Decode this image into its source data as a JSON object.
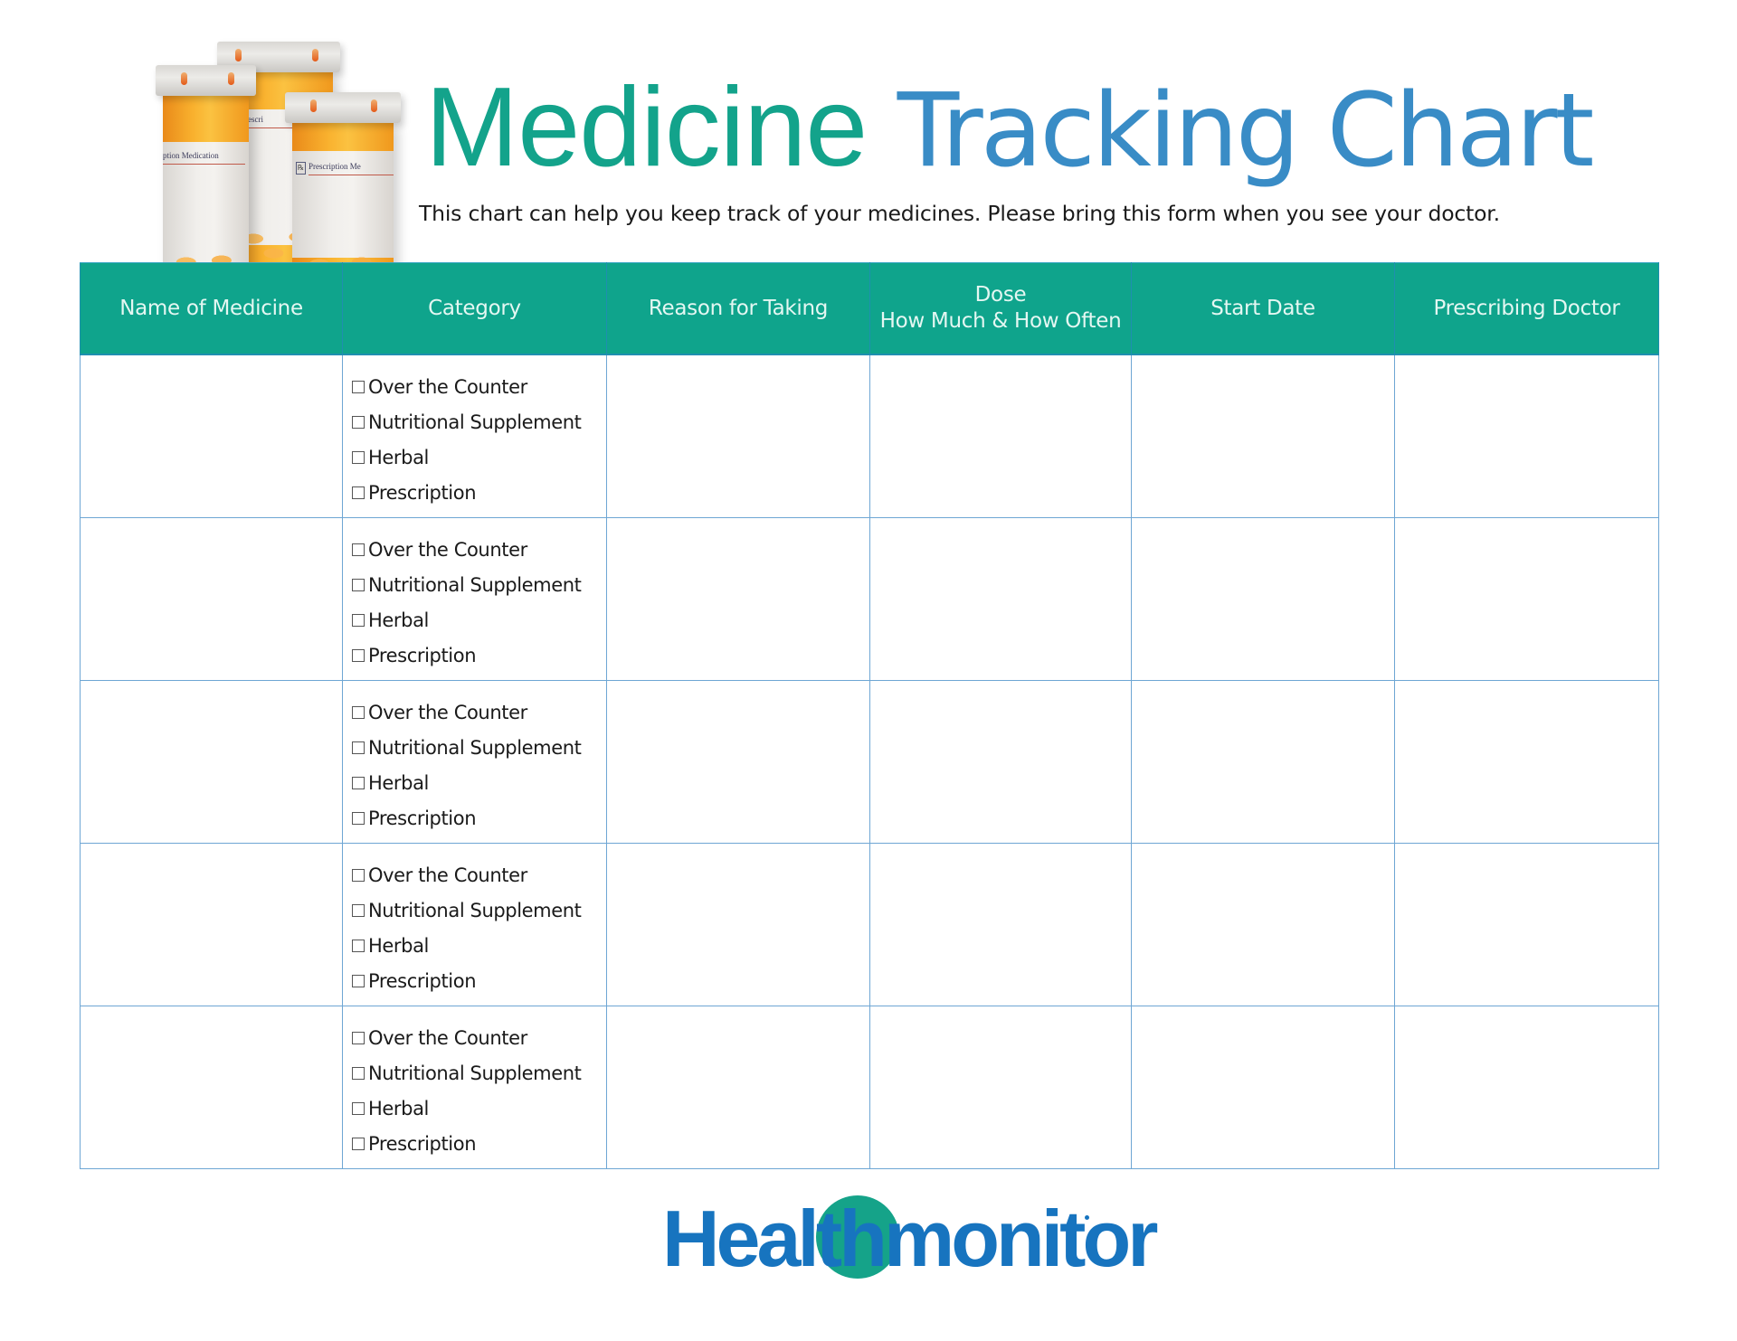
{
  "header": {
    "title_part1": "Medicine",
    "title_part2": "Tracking Chart",
    "subtitle": "This chart can help you keep track of your medicines. Please bring this form when you see your doctor."
  },
  "illustration": {
    "icon": "prescription-bottles-icon",
    "bottle_labels": [
      "ption Medication",
      "Prescri",
      "Prescription Me"
    ],
    "rx_symbol": "℞"
  },
  "table": {
    "columns": [
      {
        "label": "Name of Medicine"
      },
      {
        "label": "Category"
      },
      {
        "label": "Reason for Taking"
      },
      {
        "label_line1": "Dose",
        "label_line2": "How Much & How Often"
      },
      {
        "label": "Start Date"
      },
      {
        "label": "Prescribing Doctor"
      }
    ],
    "category_options": [
      "Over the Counter",
      "Nutritional Supplement",
      "Herbal",
      "Prescription"
    ],
    "rows": [
      {
        "name": "",
        "reason": "",
        "dose": "",
        "start_date": "",
        "doctor": "",
        "checked": [
          false,
          false,
          false,
          false
        ]
      },
      {
        "name": "",
        "reason": "",
        "dose": "",
        "start_date": "",
        "doctor": "",
        "checked": [
          false,
          false,
          false,
          false
        ]
      },
      {
        "name": "",
        "reason": "",
        "dose": "",
        "start_date": "",
        "doctor": "",
        "checked": [
          false,
          false,
          false,
          false
        ]
      },
      {
        "name": "",
        "reason": "",
        "dose": "",
        "start_date": "",
        "doctor": "",
        "checked": [
          false,
          false,
          false,
          false
        ]
      },
      {
        "name": "",
        "reason": "",
        "dose": "",
        "start_date": "",
        "doctor": "",
        "checked": [
          false,
          false,
          false,
          false
        ]
      }
    ]
  },
  "footer": {
    "logo_text_part1": "Healt",
    "logo_text_part2": "h",
    "logo_text_part3": "monitor"
  },
  "colors": {
    "teal": "#0fa48c",
    "blue": "#2f86c4",
    "grid": "#6ea6d4",
    "logo_blue": "#1774bf"
  }
}
